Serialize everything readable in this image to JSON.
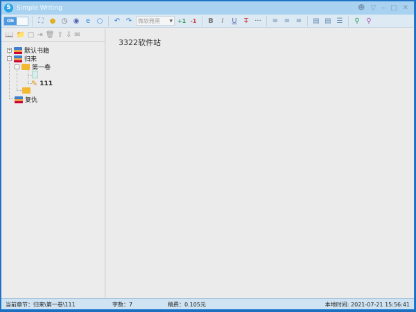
{
  "app": {
    "title": "Simple Writing",
    "logo_letter": "S"
  },
  "title_controls": [
    "user-icon",
    "dropdown-icon",
    "minimize-icon",
    "maximize-icon",
    "close-icon"
  ],
  "toolbar": {
    "toggle_label": "ON",
    "font_name": "微软雅黑",
    "increase_label": "+1",
    "decrease_label": "-1",
    "bold": "B",
    "italic": "I",
    "underline": "U",
    "strike": "T",
    "more": "···"
  },
  "tree": {
    "books": [
      {
        "label": "默认书籍"
      },
      {
        "label": "归来",
        "volumes": [
          {
            "label": "第一卷",
            "chapters": [
              {
                "label": ""
              },
              {
                "label": "111"
              }
            ]
          },
          {
            "label": ""
          }
        ]
      },
      {
        "label": "复仇"
      }
    ]
  },
  "editor": {
    "content": "3322软件站"
  },
  "status": {
    "chapter": "当前章节：归来\\第一卷\\111",
    "words": "字数：7",
    "fee": "稿费：0.105元",
    "time": "本地时间: 2021-07-21 15:56:41"
  }
}
